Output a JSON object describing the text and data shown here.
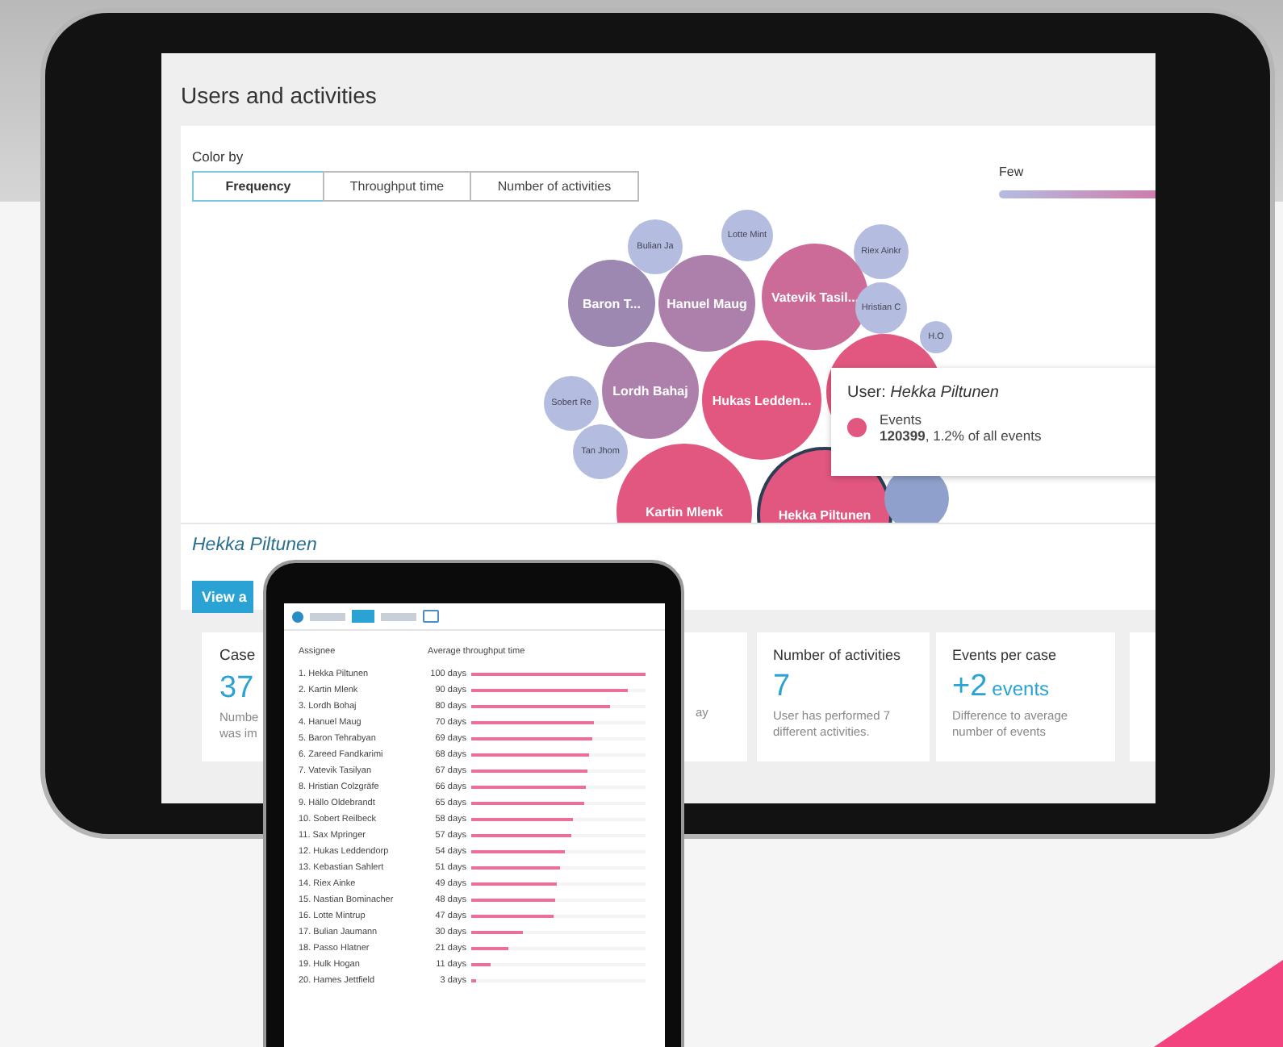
{
  "screen": {
    "title": "Users and activities",
    "color_by": {
      "label": "Color by",
      "options": [
        {
          "label": "Frequency",
          "selected": true
        },
        {
          "label": "Throughput time",
          "selected": false
        },
        {
          "label": "Number of activities",
          "selected": false
        }
      ]
    },
    "legend": {
      "label": "Few"
    },
    "bubbles": [
      {
        "label": "Bulian Ja",
        "color": "#b4bde0",
        "selected": false
      },
      {
        "label": "Lotte Mint",
        "color": "#b4bde0",
        "selected": false
      },
      {
        "label": "Riex Ainkr",
        "color": "#b4bde0",
        "selected": false
      },
      {
        "label": "Baron T...",
        "color": "#9c88b0",
        "selected": false
      },
      {
        "label": "Hanuel Maug",
        "color": "#ad80ab",
        "selected": false
      },
      {
        "label": "Vatevik Tasil...",
        "color": "#cc6b98",
        "selected": false
      },
      {
        "label": "Hristian C",
        "color": "#b4bde0",
        "selected": false
      },
      {
        "label": "H.O",
        "color": "#b4bde0",
        "selected": false
      },
      {
        "label": "Sobert Re",
        "color": "#b4bde0",
        "selected": false
      },
      {
        "label": "Lordh Bahaj",
        "color": "#ad80ab",
        "selected": false
      },
      {
        "label": "Hukas Ledden...",
        "color": "#e2577f",
        "selected": false
      },
      {
        "color": "#e2577f",
        "selected": false
      },
      {
        "label": "Tan Jhom",
        "color": "#b4bde0",
        "selected": false
      },
      {
        "label": "Kartin Mlenk",
        "color": "#e2577f",
        "selected": false
      },
      {
        "label": "Hekka Piltunen",
        "color": "#e2577f",
        "selected": true
      },
      {
        "color": "#8fa0cc",
        "selected": false
      }
    ],
    "tooltip": {
      "title": "User: *Hekka Piltunen*",
      "metric": "Events",
      "value": "**120399**, 1.2% of all events",
      "color": "#e2577f"
    },
    "user_name": "Hekka Piltunen",
    "view_button": "View a",
    "cards": [
      {
        "title": "Case",
        "value": "37",
        "lines": [
          "Numbe",
          "was im"
        ]
      },
      {
        "lines": [
          "ay"
        ]
      },
      {
        "title": "Number of activities",
        "value": "7",
        "lines": [
          "User has performed 7",
          "different activities."
        ]
      },
      {
        "title": "Events per case",
        "value": "+2",
        "unit": "events",
        "lines": [
          "Difference to average",
          "number of events"
        ]
      }
    ]
  },
  "small_tablet": {
    "columns": [
      "Assignee",
      "Average throughput time"
    ],
    "rows": [
      {
        "name": "1. Hekka Piltunen",
        "value": "100 days",
        "level": 1.0
      },
      {
        "name": "2. Kartin Mlenk",
        "value": "90 days",
        "level": 0.9
      },
      {
        "name": "3. Lordh Bohaj",
        "value": "80 days",
        "level": 0.8
      },
      {
        "name": "4. Hanuel Maug",
        "value": "70 days",
        "level": 0.7
      },
      {
        "name": "5. Baron Tehrabyan",
        "value": "69 days",
        "level": 0.69
      },
      {
        "name": "6. Zareed Fandkarimi",
        "value": "68 days",
        "level": 0.68
      },
      {
        "name": "7. Vatevik Tasilyan",
        "value": "67 days",
        "level": 0.67
      },
      {
        "name": "8. Hristian Colzgräfe",
        "value": "66 days",
        "level": 0.66
      },
      {
        "name": "9. Hällo Oldebrandt",
        "value": "65 days",
        "level": 0.65
      },
      {
        "name": "10. Sobert Reilbeck",
        "value": "58 days",
        "level": 0.58
      },
      {
        "name": "11. Sax Mpringer",
        "value": "57 days",
        "level": 0.57
      },
      {
        "name": "12. Hukas Leddendorp",
        "value": "54 days",
        "level": 0.54
      },
      {
        "name": "13. Kebastian Sahlert",
        "value": "51 days",
        "level": 0.51
      },
      {
        "name": "14. Riex Ainke",
        "value": "49 days",
        "level": 0.49
      },
      {
        "name": "15. Nastian Bominacher",
        "value": "48 days",
        "level": 0.48
      },
      {
        "name": "16. Lotte Mintrup",
        "value": "47 days",
        "level": 0.47
      },
      {
        "name": "17. Bulian Jaumann",
        "value": "30 days",
        "level": 0.3
      },
      {
        "name": "18. Passo Hlatner",
        "value": "21 days",
        "level": 0.21
      },
      {
        "name": "19. Hulk Hogan",
        "value": "11 days",
        "level": 0.11
      },
      {
        "name": "20. Hames Jettfield",
        "value": "3 days",
        "level": 0.03
      }
    ]
  }
}
